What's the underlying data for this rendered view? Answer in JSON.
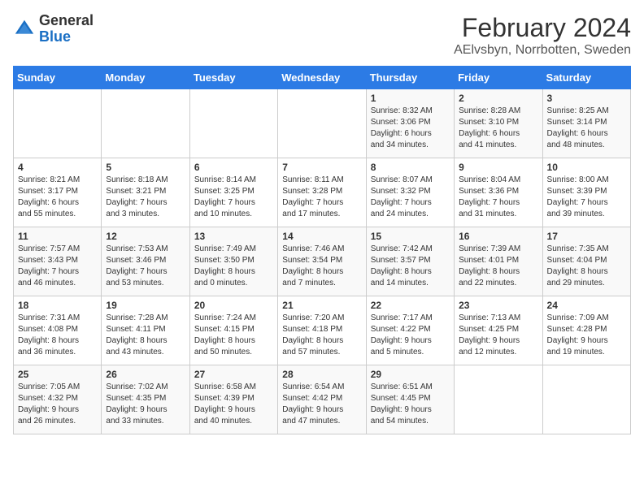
{
  "header": {
    "logo_general": "General",
    "logo_blue": "Blue",
    "month_year": "February 2024",
    "location": "AElvsbyn, Norrbotten, Sweden"
  },
  "days_of_week": [
    "Sunday",
    "Monday",
    "Tuesday",
    "Wednesday",
    "Thursday",
    "Friday",
    "Saturday"
  ],
  "weeks": [
    [
      {
        "day": "",
        "info": ""
      },
      {
        "day": "",
        "info": ""
      },
      {
        "day": "",
        "info": ""
      },
      {
        "day": "",
        "info": ""
      },
      {
        "day": "1",
        "info": "Sunrise: 8:32 AM\nSunset: 3:06 PM\nDaylight: 6 hours\nand 34 minutes."
      },
      {
        "day": "2",
        "info": "Sunrise: 8:28 AM\nSunset: 3:10 PM\nDaylight: 6 hours\nand 41 minutes."
      },
      {
        "day": "3",
        "info": "Sunrise: 8:25 AM\nSunset: 3:14 PM\nDaylight: 6 hours\nand 48 minutes."
      }
    ],
    [
      {
        "day": "4",
        "info": "Sunrise: 8:21 AM\nSunset: 3:17 PM\nDaylight: 6 hours\nand 55 minutes."
      },
      {
        "day": "5",
        "info": "Sunrise: 8:18 AM\nSunset: 3:21 PM\nDaylight: 7 hours\nand 3 minutes."
      },
      {
        "day": "6",
        "info": "Sunrise: 8:14 AM\nSunset: 3:25 PM\nDaylight: 7 hours\nand 10 minutes."
      },
      {
        "day": "7",
        "info": "Sunrise: 8:11 AM\nSunset: 3:28 PM\nDaylight: 7 hours\nand 17 minutes."
      },
      {
        "day": "8",
        "info": "Sunrise: 8:07 AM\nSunset: 3:32 PM\nDaylight: 7 hours\nand 24 minutes."
      },
      {
        "day": "9",
        "info": "Sunrise: 8:04 AM\nSunset: 3:36 PM\nDaylight: 7 hours\nand 31 minutes."
      },
      {
        "day": "10",
        "info": "Sunrise: 8:00 AM\nSunset: 3:39 PM\nDaylight: 7 hours\nand 39 minutes."
      }
    ],
    [
      {
        "day": "11",
        "info": "Sunrise: 7:57 AM\nSunset: 3:43 PM\nDaylight: 7 hours\nand 46 minutes."
      },
      {
        "day": "12",
        "info": "Sunrise: 7:53 AM\nSunset: 3:46 PM\nDaylight: 7 hours\nand 53 minutes."
      },
      {
        "day": "13",
        "info": "Sunrise: 7:49 AM\nSunset: 3:50 PM\nDaylight: 8 hours\nand 0 minutes."
      },
      {
        "day": "14",
        "info": "Sunrise: 7:46 AM\nSunset: 3:54 PM\nDaylight: 8 hours\nand 7 minutes."
      },
      {
        "day": "15",
        "info": "Sunrise: 7:42 AM\nSunset: 3:57 PM\nDaylight: 8 hours\nand 14 minutes."
      },
      {
        "day": "16",
        "info": "Sunrise: 7:39 AM\nSunset: 4:01 PM\nDaylight: 8 hours\nand 22 minutes."
      },
      {
        "day": "17",
        "info": "Sunrise: 7:35 AM\nSunset: 4:04 PM\nDaylight: 8 hours\nand 29 minutes."
      }
    ],
    [
      {
        "day": "18",
        "info": "Sunrise: 7:31 AM\nSunset: 4:08 PM\nDaylight: 8 hours\nand 36 minutes."
      },
      {
        "day": "19",
        "info": "Sunrise: 7:28 AM\nSunset: 4:11 PM\nDaylight: 8 hours\nand 43 minutes."
      },
      {
        "day": "20",
        "info": "Sunrise: 7:24 AM\nSunset: 4:15 PM\nDaylight: 8 hours\nand 50 minutes."
      },
      {
        "day": "21",
        "info": "Sunrise: 7:20 AM\nSunset: 4:18 PM\nDaylight: 8 hours\nand 57 minutes."
      },
      {
        "day": "22",
        "info": "Sunrise: 7:17 AM\nSunset: 4:22 PM\nDaylight: 9 hours\nand 5 minutes."
      },
      {
        "day": "23",
        "info": "Sunrise: 7:13 AM\nSunset: 4:25 PM\nDaylight: 9 hours\nand 12 minutes."
      },
      {
        "day": "24",
        "info": "Sunrise: 7:09 AM\nSunset: 4:28 PM\nDaylight: 9 hours\nand 19 minutes."
      }
    ],
    [
      {
        "day": "25",
        "info": "Sunrise: 7:05 AM\nSunset: 4:32 PM\nDaylight: 9 hours\nand 26 minutes."
      },
      {
        "day": "26",
        "info": "Sunrise: 7:02 AM\nSunset: 4:35 PM\nDaylight: 9 hours\nand 33 minutes."
      },
      {
        "day": "27",
        "info": "Sunrise: 6:58 AM\nSunset: 4:39 PM\nDaylight: 9 hours\nand 40 minutes."
      },
      {
        "day": "28",
        "info": "Sunrise: 6:54 AM\nSunset: 4:42 PM\nDaylight: 9 hours\nand 47 minutes."
      },
      {
        "day": "29",
        "info": "Sunrise: 6:51 AM\nSunset: 4:45 PM\nDaylight: 9 hours\nand 54 minutes."
      },
      {
        "day": "",
        "info": ""
      },
      {
        "day": "",
        "info": ""
      }
    ]
  ]
}
